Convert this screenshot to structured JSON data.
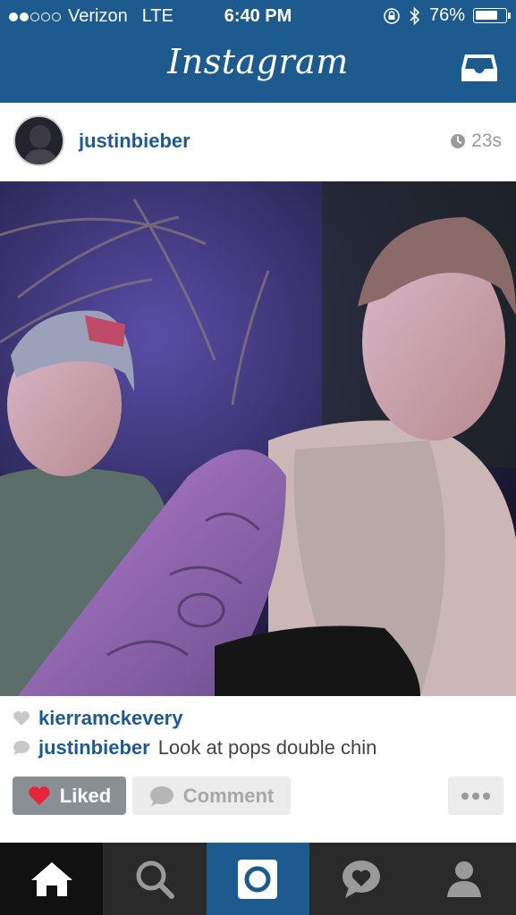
{
  "status_bar": {
    "carrier": "Verizon",
    "network": "LTE",
    "time": "6:40 PM",
    "battery": "76%",
    "battery_level": 0.76,
    "signal_bars_filled": 2,
    "signal_bars_total": 5
  },
  "nav": {
    "title": "Instagram",
    "inbox_icon": "inbox-tray-icon"
  },
  "post": {
    "username": "justinbieber",
    "age": "23s",
    "likes_user": "kierramckevery",
    "caption_user": "justinbieber",
    "caption_text": "Look at pops double chin"
  },
  "actions": {
    "liked_label": "Liked",
    "comment_label": "Comment"
  },
  "tabs": [
    "home-icon",
    "search-icon",
    "camera-icon",
    "activity-heart-icon",
    "profile-icon"
  ],
  "colors": {
    "brand_blue": "#1d5a8e",
    "like_red": "#e8253a",
    "tabbar_bg": "#2a2a2a"
  }
}
